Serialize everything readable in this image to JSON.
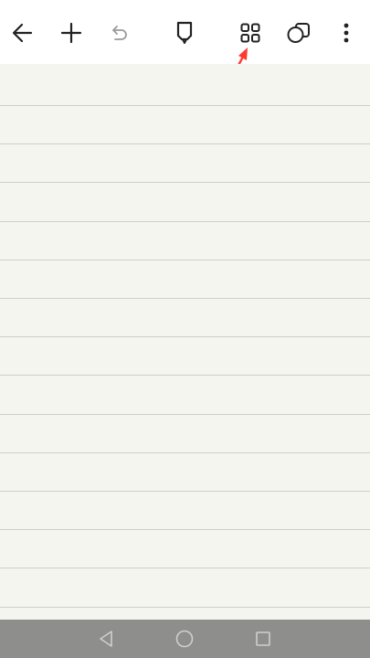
{
  "toolbar": {
    "buttons": [
      {
        "name": "back-button",
        "icon": "arrow-left-icon"
      },
      {
        "name": "add-button",
        "icon": "plus-icon"
      },
      {
        "name": "undo-button",
        "icon": "undo-icon",
        "state": "disabled"
      },
      {
        "name": "pen-button",
        "icon": "pen-icon"
      },
      {
        "name": "grid-view-button",
        "icon": "grid-icon",
        "highlighted": true
      },
      {
        "name": "shapes-button",
        "icon": "shapes-icon"
      },
      {
        "name": "more-options-button",
        "icon": "more-vertical-icon"
      }
    ]
  },
  "canvas": {
    "type": "lined-notepaper",
    "background_color": "#f5f5f0",
    "line_color": "#cfcfca"
  },
  "annotation": {
    "icon": "red-arrow-icon",
    "color": "#ff3b30",
    "points_to": "grid-view-button"
  },
  "navbar": {
    "buttons": [
      {
        "name": "nav-back-button",
        "icon": "triangle-back-icon"
      },
      {
        "name": "nav-home-button",
        "icon": "circle-home-icon"
      },
      {
        "name": "nav-recents-button",
        "icon": "square-recents-icon"
      }
    ],
    "background_color": "#8e8e8c"
  }
}
